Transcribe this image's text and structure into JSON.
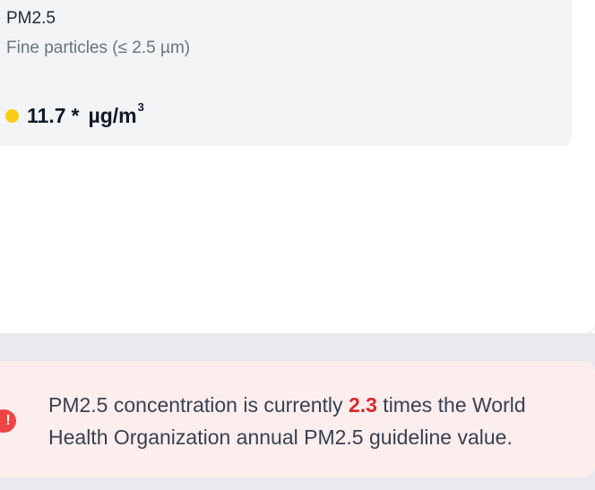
{
  "metric": {
    "name": "PM2.5",
    "description": "Fine particles (≤ 2.5 µm)",
    "value": "11.7",
    "flag": "*",
    "unit": "µg/m",
    "unit_exponent": "3",
    "status_color": "#facc15"
  },
  "alert": {
    "icon": "exclamation-circle-icon",
    "icon_glyph": "!",
    "icon_color": "#ef4444",
    "text_before": "PM2.5 concentration is currently ",
    "ratio": "2.3",
    "ratio_color": "#dc2626",
    "text_after": " times the World Health Organization annual PM2.5 guideline value."
  }
}
